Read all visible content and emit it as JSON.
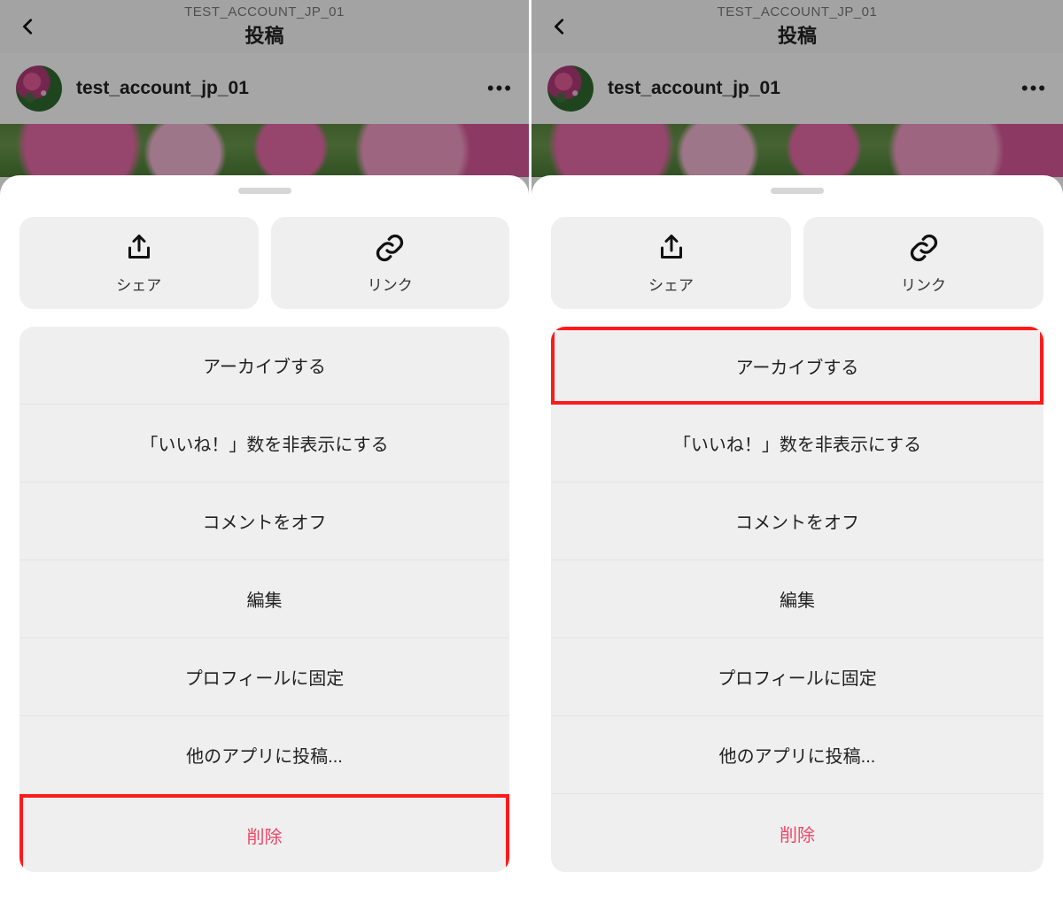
{
  "panels": {
    "left": {
      "highlight_index": 6
    },
    "right": {
      "highlight_index": 0
    }
  },
  "header": {
    "subtitle": "TEST_ACCOUNT_JP_01",
    "title": "投稿"
  },
  "post": {
    "username": "test_account_jp_01",
    "kebab": "•••"
  },
  "sheet": {
    "share_label": "シェア",
    "link_label": "リンク",
    "items": [
      {
        "label": "アーカイブする",
        "danger": false
      },
      {
        "label": "「いいね！」数を非表示にする",
        "danger": false
      },
      {
        "label": "コメントをオフ",
        "danger": false
      },
      {
        "label": "編集",
        "danger": false
      },
      {
        "label": "プロフィールに固定",
        "danger": false
      },
      {
        "label": "他のアプリに投稿...",
        "danger": false
      },
      {
        "label": "削除",
        "danger": true
      }
    ]
  }
}
